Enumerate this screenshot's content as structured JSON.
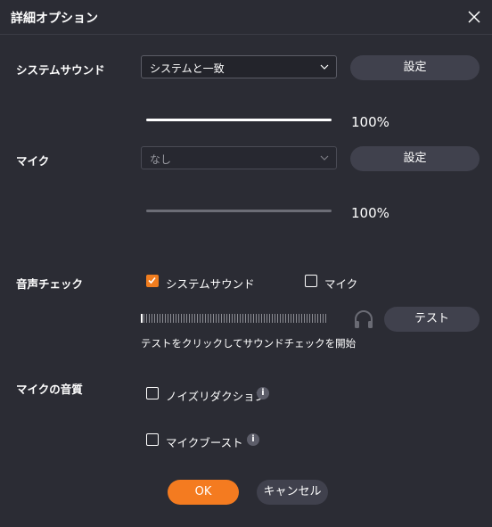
{
  "window": {
    "title": "詳細オプション"
  },
  "system_sound": {
    "label": "システムサウンド",
    "device": "システムと一致",
    "settings_label": "設定",
    "volume_text": "100%"
  },
  "mic": {
    "label": "マイク",
    "device": "なし",
    "settings_label": "設定",
    "volume_text": "100%"
  },
  "sound_check": {
    "label": "音声チェック",
    "system_sound_option": "システムサウンド",
    "system_sound_checked": true,
    "mic_option": "マイク",
    "mic_checked": false,
    "test_label": "テスト",
    "hint": "テストをクリックしてサウンドチェックを開始"
  },
  "mic_quality": {
    "label": "マイクの音質",
    "noise_reduction": "ノイズリダクション",
    "noise_reduction_checked": false,
    "mic_boost": "マイクブースト",
    "mic_boost_checked": false,
    "info_glyph": "i"
  },
  "footer": {
    "ok_label": "OK",
    "cancel_label": "キャンセル"
  },
  "colors": {
    "accent": "#f47b20",
    "background": "#2b2c34",
    "button": "#40414d"
  }
}
